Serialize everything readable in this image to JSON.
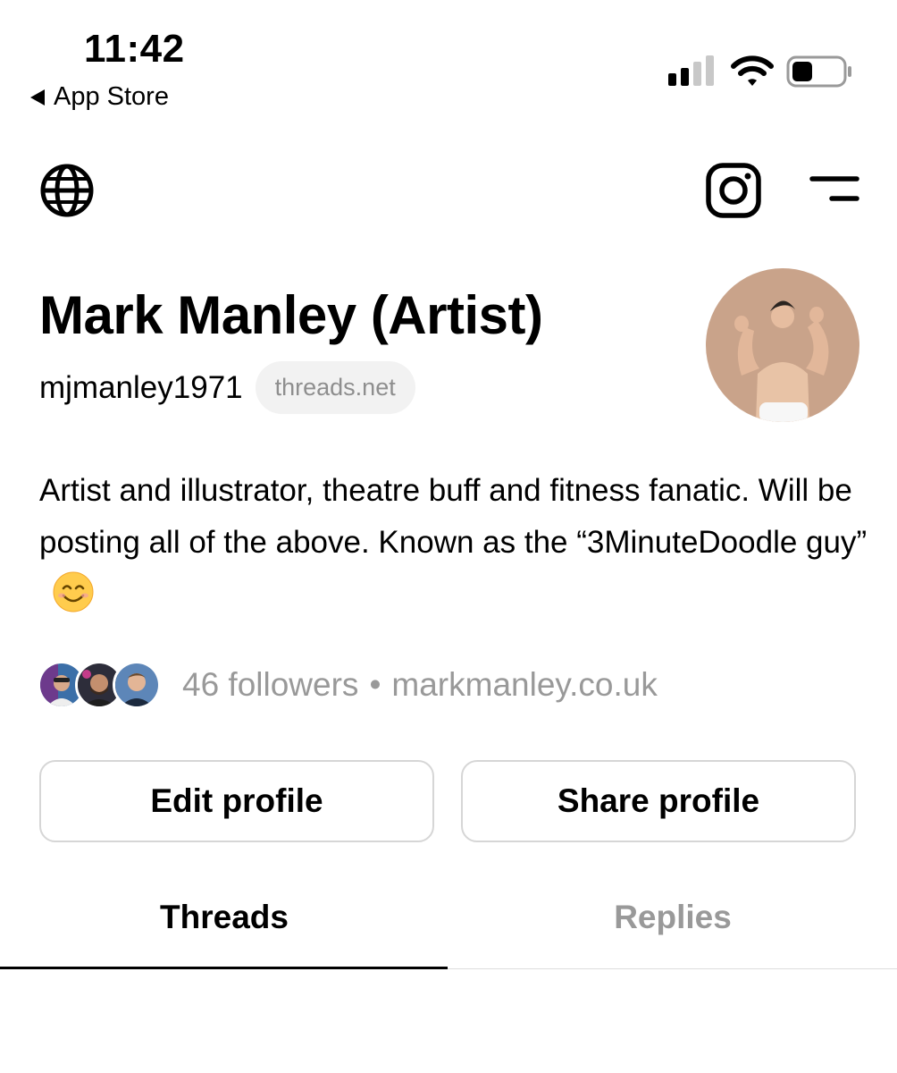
{
  "status_bar": {
    "time": "11:42",
    "back_label": "App Store"
  },
  "nav": {
    "left_icon": "globe-icon",
    "right_icons": [
      "instagram-icon",
      "menu-icon"
    ]
  },
  "profile": {
    "name": "Mark Manley (Artist)",
    "handle": "mjmanley1971",
    "domain_badge": "threads.net",
    "bio": "Artist and illustrator, theatre buff and fitness fanatic. Will be posting all of the above. Known as the “3MinuteDoodle guy”",
    "followers_text": "46 followers",
    "separator": "•",
    "website": "markmanley.co.uk"
  },
  "actions": {
    "edit_label": "Edit profile",
    "share_label": "Share profile"
  },
  "tabs": [
    {
      "label": "Threads",
      "active": true
    },
    {
      "label": "Replies",
      "active": false
    }
  ],
  "colors": {
    "text": "#000000",
    "muted": "#999999",
    "pill_bg": "#f2f2f2",
    "border": "#d6d6d6"
  }
}
